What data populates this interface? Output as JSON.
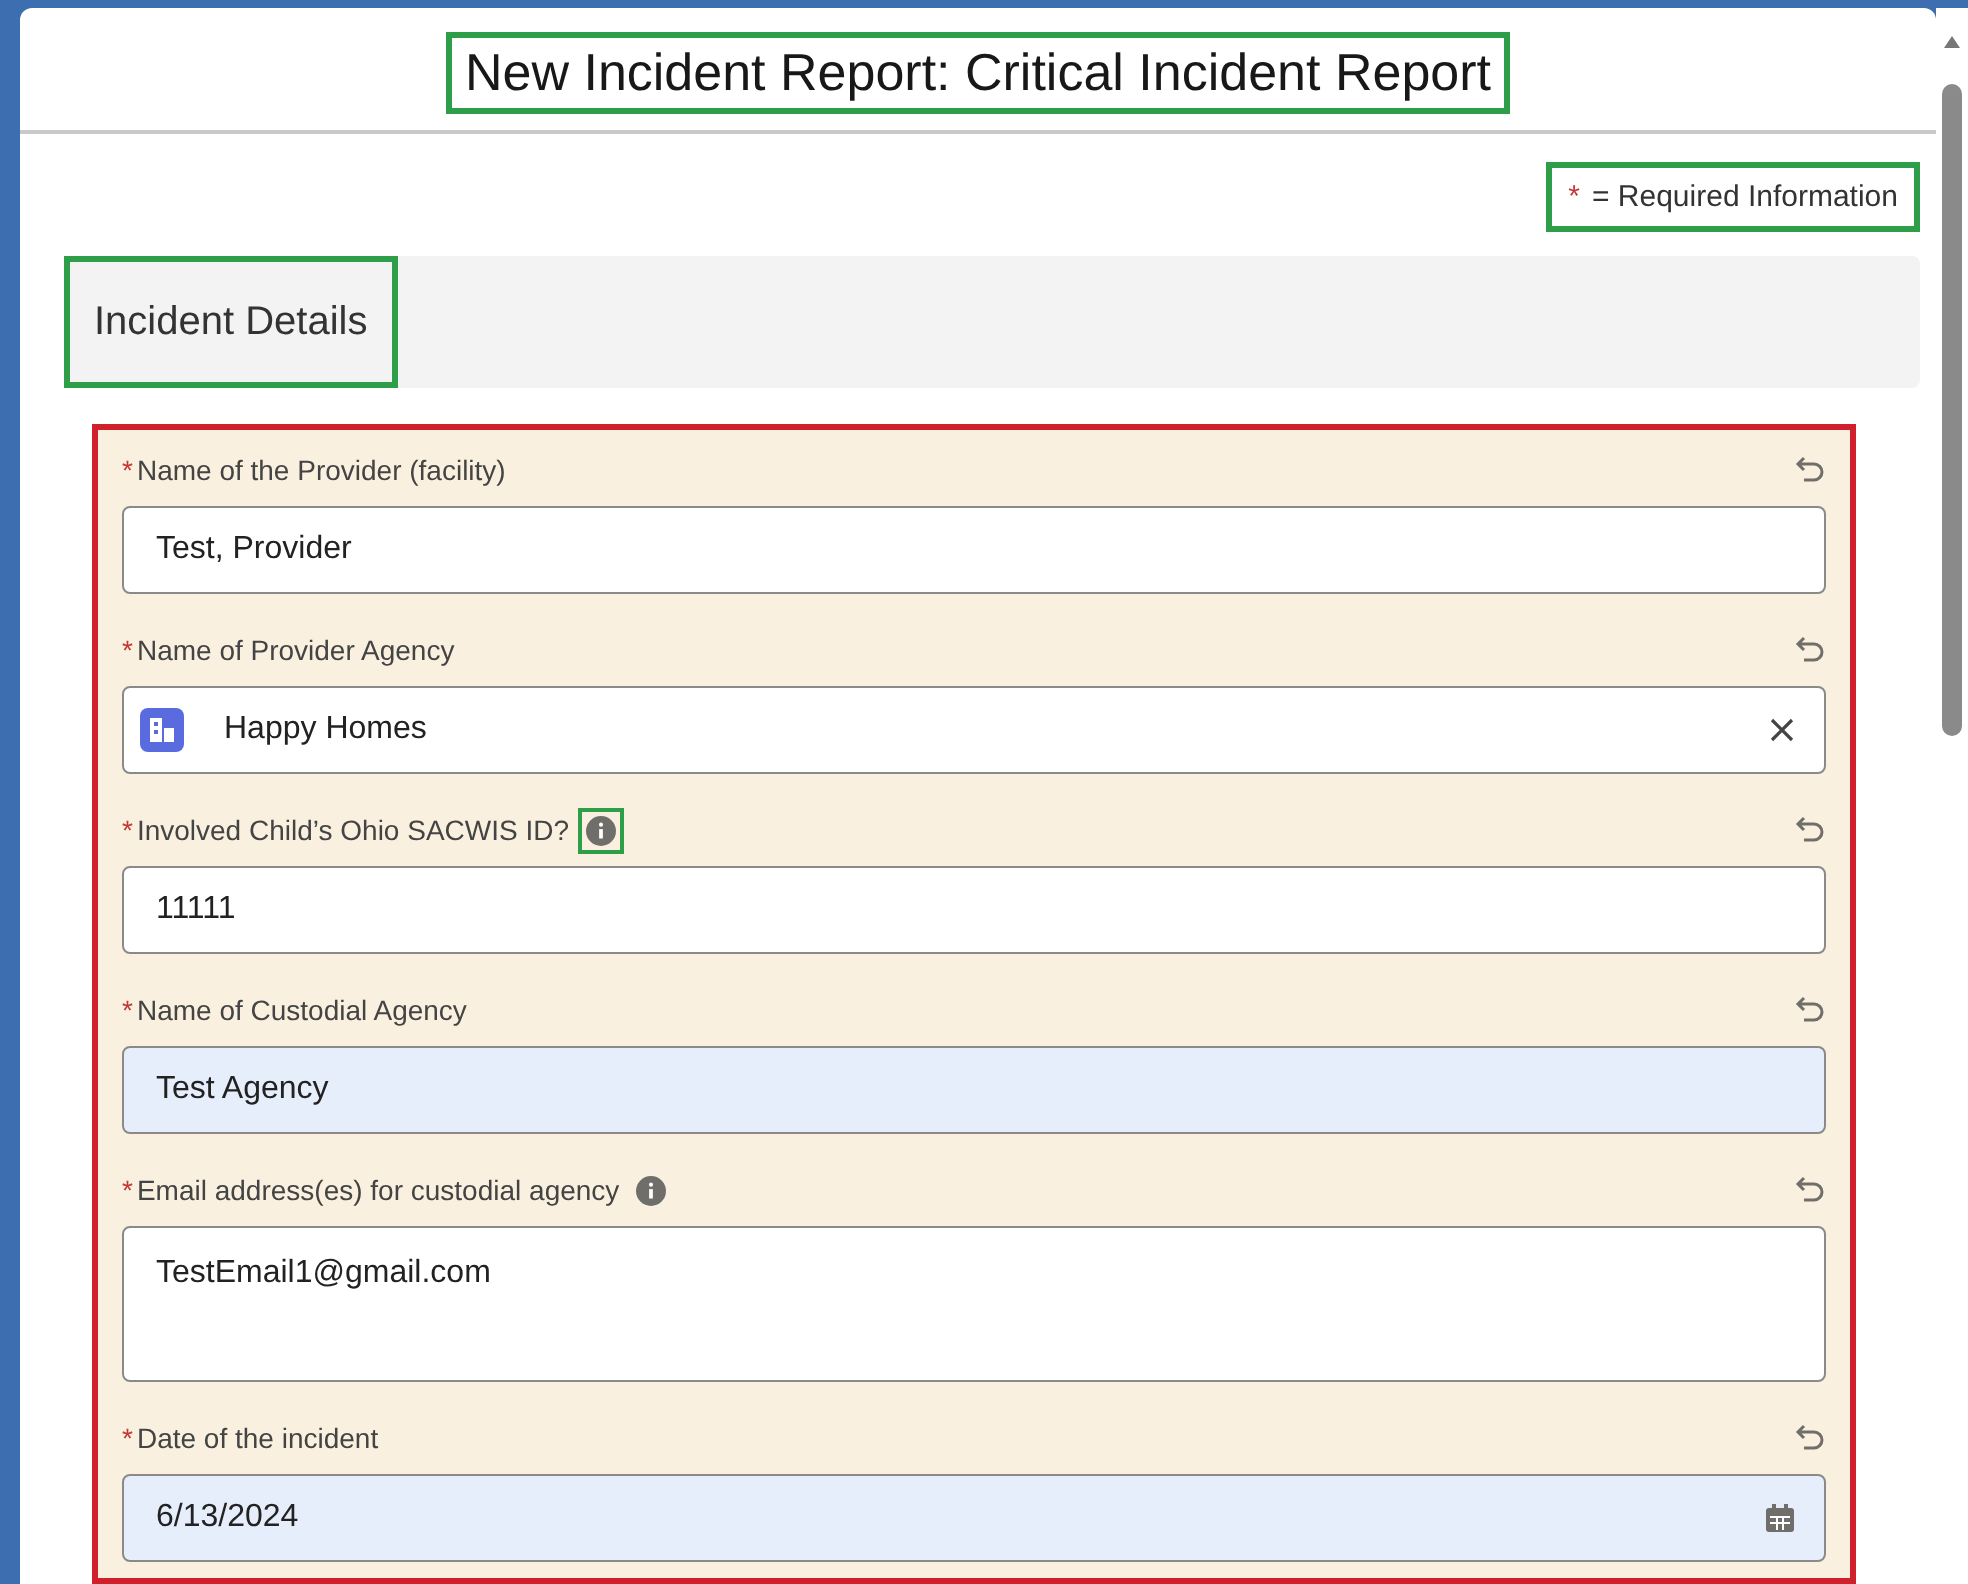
{
  "dialog": {
    "title": "New Incident Report: Critical Incident Report",
    "title_outlined": true
  },
  "required_note": {
    "mark": "*",
    "text": "= Required Information",
    "outlined": true
  },
  "section": {
    "heading": "Incident Details",
    "outlined": true,
    "fields_outlined": true
  },
  "fields": [
    {
      "kind": "text",
      "label": "Name of the Provider (facility)",
      "required": true,
      "value": "Test, Provider",
      "highlighted": false,
      "info": false
    },
    {
      "kind": "lookup",
      "label": "Name of Provider Agency",
      "required": true,
      "value": "Happy Homes",
      "highlighted": false,
      "info": false
    },
    {
      "kind": "text",
      "label": "Involved Child’s Ohio SACWIS ID?",
      "required": true,
      "value": "11111",
      "highlighted": false,
      "info": true,
      "info_outlined": true
    },
    {
      "kind": "text",
      "label": "Name of Custodial Agency",
      "required": true,
      "value": "Test Agency",
      "highlighted": true,
      "info": false
    },
    {
      "kind": "textarea",
      "label": "Email address(es) for custodial agency",
      "required": true,
      "value": "TestEmail1@gmail.com",
      "highlighted": false,
      "info": true,
      "info_outlined": false
    },
    {
      "kind": "date",
      "label": "Date of the incident",
      "required": true,
      "value": "6/13/2024",
      "highlighted": true,
      "info": false
    }
  ]
}
